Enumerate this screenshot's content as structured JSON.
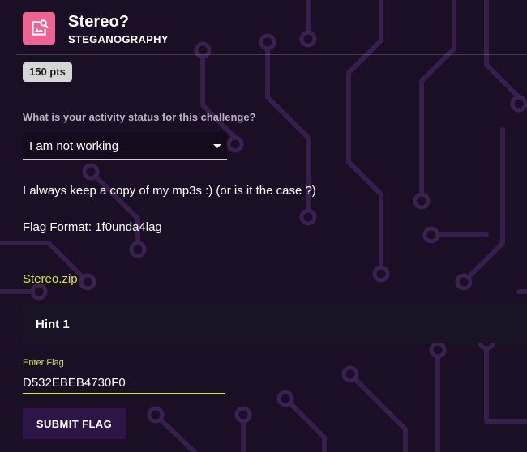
{
  "challenge": {
    "title": "Stereo?",
    "category": "STEGANOGRAPHY",
    "points": "150 pts",
    "icon": "image-search-icon",
    "icon_color": "#f06292"
  },
  "status": {
    "question": "What is your activity status for this challenge?",
    "selected": "I am not working"
  },
  "description": {
    "text": "I always keep a copy of my mp3s :) (or is it the case ?)",
    "flag_format": "Flag Format: 1f0unda4lag"
  },
  "attachment": {
    "label": "Stereo.zip"
  },
  "hints": [
    {
      "label": "Hint 1"
    }
  ],
  "flag_form": {
    "label": "Enter Flag",
    "value": "D532EBEB4730F0",
    "submit_label": "SUBMIT FLAG"
  },
  "colors": {
    "background": "#1a0f25",
    "circuit_trace": "#3a2150",
    "accent": "#d4e157",
    "button": "#2d1548",
    "badge": "#d6d6d6"
  }
}
